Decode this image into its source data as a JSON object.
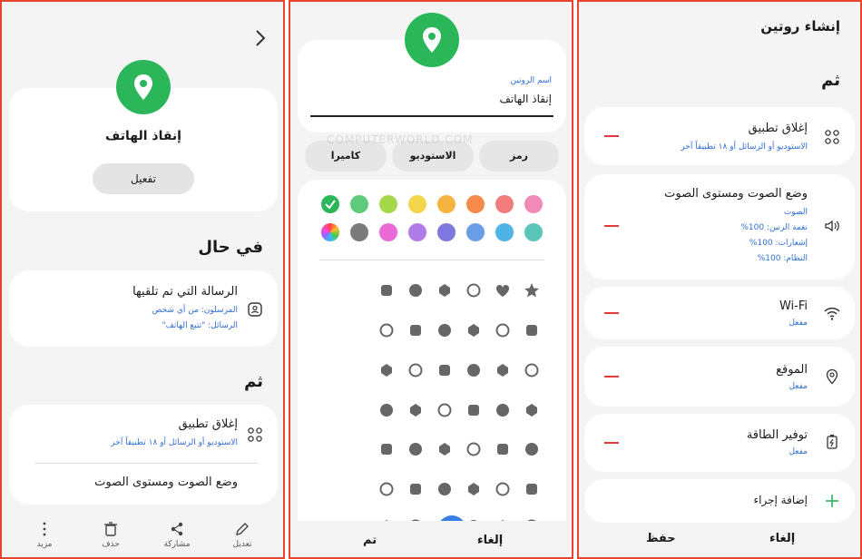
{
  "panel1": {
    "routine_name": "إنقاذ الهاتف",
    "activate_label": "تفعيل",
    "if_heading": "في حال",
    "trigger": {
      "title": "الرسالة التي تم تلقيها",
      "senders": "المرسلون: من أي شخص",
      "messages": "الرسائل: \"تتبع الهاتف\""
    },
    "then_heading": "ثم",
    "actions": [
      {
        "title": "إغلاق تطبيق",
        "subtitle": "الاستوديو أو الرسائل أو ١٨ تطبيقاً آخر"
      },
      {
        "title": "وضع الصوت ومستوى الصوت",
        "subtitle": ""
      }
    ],
    "bottom_nav": [
      {
        "label": "تعديل",
        "icon": "pencil-icon"
      },
      {
        "label": "مشاركة",
        "icon": "share-icon"
      },
      {
        "label": "حذف",
        "icon": "trash-icon"
      },
      {
        "label": "مزيد",
        "icon": "more-icon"
      }
    ]
  },
  "panel2": {
    "name_label": "اسم الروتين",
    "name_value": "إنقاذ الهاتف",
    "tabs": [
      "رمز",
      "الاستوديو",
      "كاميرا"
    ],
    "colors": [
      "#f28ab8",
      "#f27b7b",
      "#f58a4a",
      "#f5b340",
      "#f2d54a",
      "#a6d94a",
      "#5ecb7a",
      "#2cb65a",
      "#5bc6b8",
      "#4fb3e8",
      "#6a9de8",
      "#7d78e0",
      "#b07ae8",
      "#ea6ad8",
      "#7a7a7a",
      "#rainbow"
    ],
    "watermark": "COMPUTERWORLD.COM",
    "cancel_label": "إلغاء",
    "done_label": "تم"
  },
  "panel3": {
    "title": "إنشاء روتين",
    "then_heading": "ثم",
    "actions": [
      {
        "title": "إغلاق تطبيق",
        "lines": [
          "الاستوديو أو الرسائل أو ١٨ تطبيقاً آخر"
        ],
        "icon": "apps-grid-icon"
      },
      {
        "title": "وضع الصوت ومستوى الصوت",
        "lines": [
          "الصوت",
          "نغمة الرنين: 100%",
          "إشعارات: 100%",
          "النظام: 100%"
        ],
        "icon": "speaker-icon"
      },
      {
        "title": "Wi-Fi",
        "lines": [
          "مفعل"
        ],
        "icon": "wifi-icon"
      },
      {
        "title": "الموقع",
        "lines": [
          "مفعل"
        ],
        "icon": "location-icon"
      },
      {
        "title": "توفير الطاقة",
        "lines": [
          "مفعل"
        ],
        "icon": "battery-icon"
      }
    ],
    "add_action_label": "إضافة إجراء",
    "cancel_label": "إلغاء",
    "save_label": "حفظ"
  }
}
